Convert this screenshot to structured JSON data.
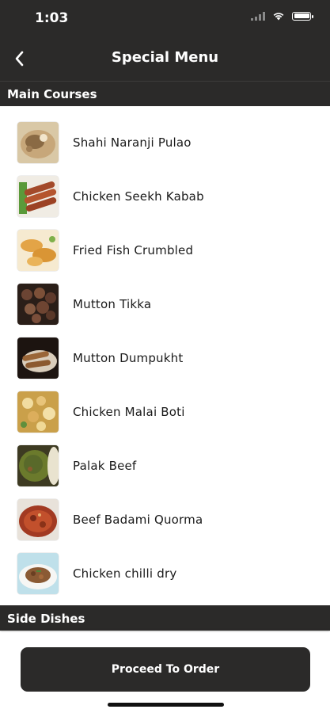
{
  "status_bar": {
    "time": "1:03"
  },
  "header": {
    "title": "Special Menu"
  },
  "sections": {
    "main_courses": "Main Courses",
    "side_dishes": "Side Dishes"
  },
  "main_courses": [
    {
      "name": "Shahi Naranji Pulao",
      "image": "pulao-photo"
    },
    {
      "name": "Chicken Seekh Kabab",
      "image": "kabab-photo"
    },
    {
      "name": "Fried Fish Crumbled",
      "image": "fish-photo"
    },
    {
      "name": "Mutton Tikka",
      "image": "tikka-photo"
    },
    {
      "name": "Mutton Dumpukht",
      "image": "dumpukht-photo"
    },
    {
      "name": "Chicken Malai Boti",
      "image": "malai-boti-photo"
    },
    {
      "name": "Palak Beef",
      "image": "palak-beef-photo"
    },
    {
      "name": "Beef Badami Quorma",
      "image": "quorma-photo"
    },
    {
      "name": "Chicken chilli dry",
      "image": "chilli-dry-photo"
    }
  ],
  "footer": {
    "button_label": "Proceed To Order"
  },
  "colors": {
    "bar": "#2b2a29",
    "text": "#1a1a1a",
    "background": "#ffffff"
  }
}
